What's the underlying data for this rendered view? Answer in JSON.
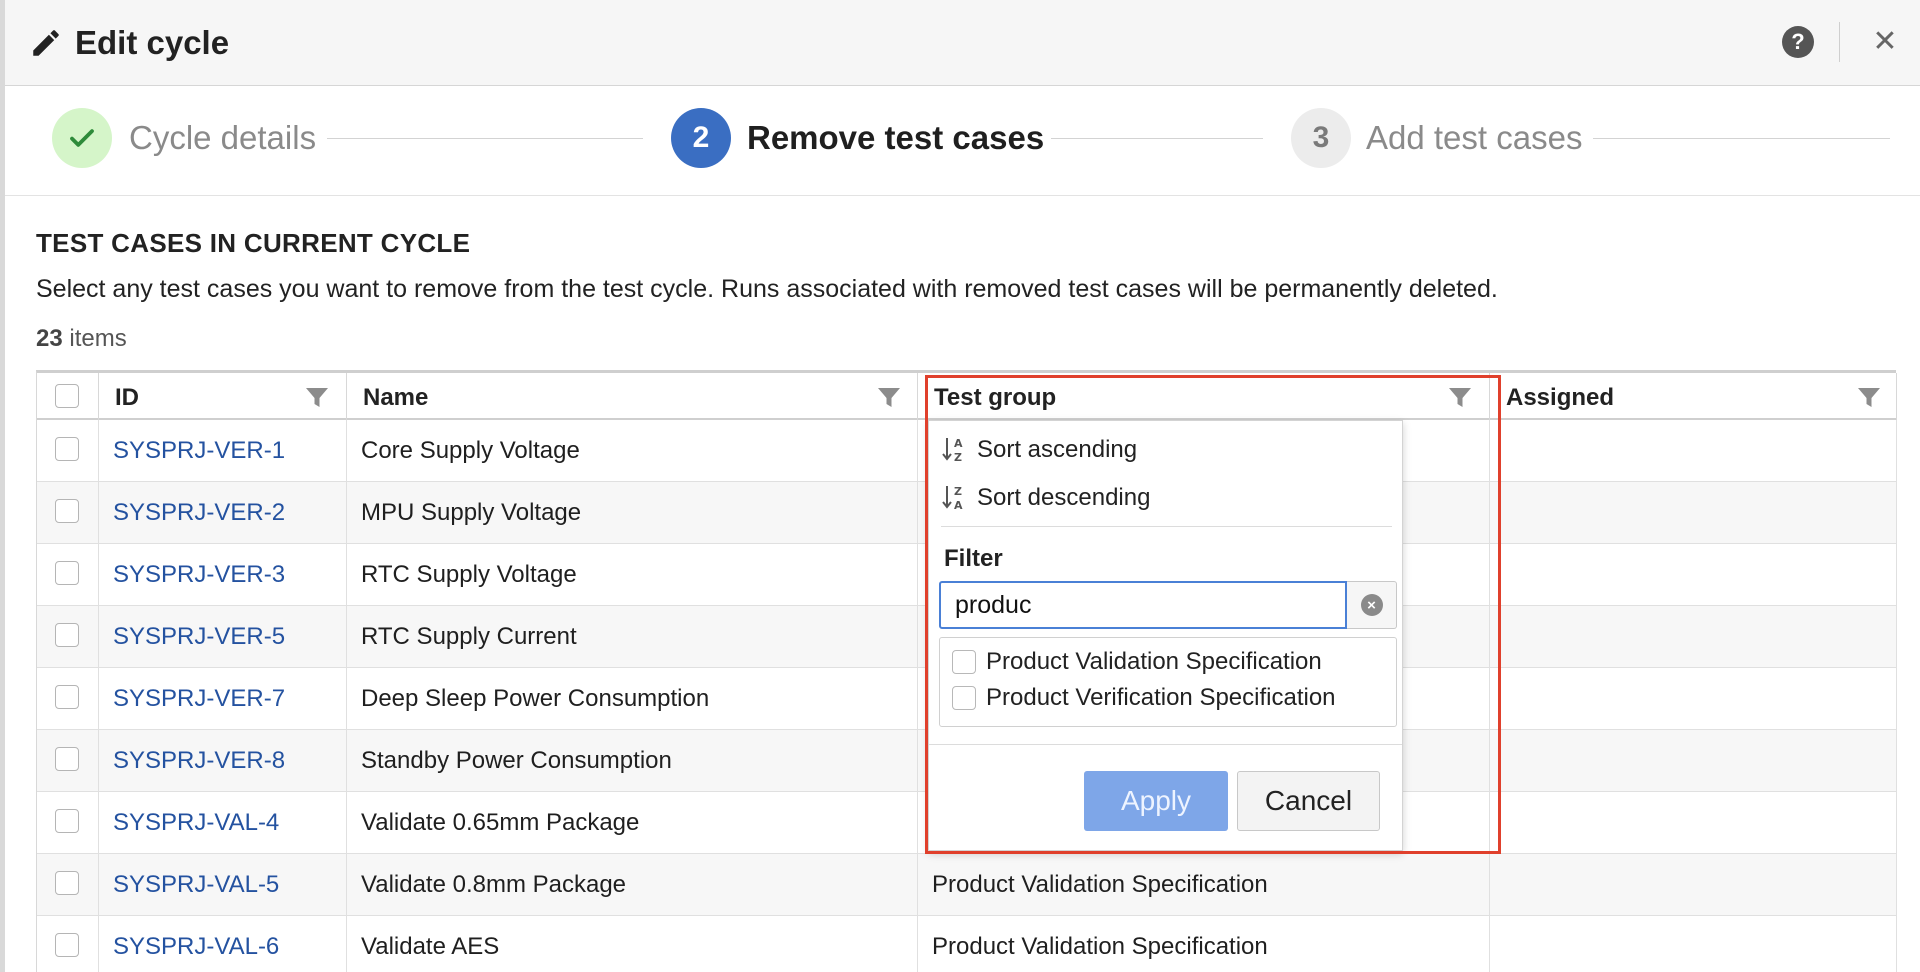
{
  "dialog": {
    "title": "Edit cycle",
    "help_icon": "question-icon",
    "close_icon": "close-icon"
  },
  "steps": [
    {
      "number": "",
      "label": "Cycle details",
      "state": "completed"
    },
    {
      "number": "2",
      "label": "Remove test cases",
      "state": "active"
    },
    {
      "number": "3",
      "label": "Add test cases",
      "state": "pending"
    }
  ],
  "colors": {
    "step_done_bg": "#d5f5c9",
    "step_done_check": "#2e8b3a",
    "step_active_bg": "#3a6ec2",
    "step_pending_bg": "#ececec",
    "link": "#2452a0",
    "highlight_border": "#e0402c",
    "apply_button": "#7ea6e8"
  },
  "section": {
    "title": "TEST CASES IN CURRENT CYCLE",
    "description": "Select any test cases you want to remove from the test cycle. Runs associated with removed test cases will be permanently deleted.",
    "count": "23",
    "count_suffix": " items"
  },
  "table": {
    "columns": [
      "ID",
      "Name",
      "Test group",
      "Assigned"
    ],
    "rows": [
      {
        "id": "SYSPRJ-VER-1",
        "name": "Core Supply Voltage",
        "group": "",
        "assigned": ""
      },
      {
        "id": "SYSPRJ-VER-2",
        "name": "MPU Supply Voltage",
        "group": "",
        "assigned": ""
      },
      {
        "id": "SYSPRJ-VER-3",
        "name": "RTC Supply Voltage",
        "group": "",
        "assigned": ""
      },
      {
        "id": "SYSPRJ-VER-5",
        "name": "RTC Supply Current",
        "group": "",
        "assigned": ""
      },
      {
        "id": "SYSPRJ-VER-7",
        "name": "Deep Sleep Power Consumption",
        "group": "",
        "assigned": ""
      },
      {
        "id": "SYSPRJ-VER-8",
        "name": "Standby Power Consumption",
        "group": "",
        "assigned": ""
      },
      {
        "id": "SYSPRJ-VAL-4",
        "name": "Validate 0.65mm Package",
        "group": "",
        "assigned": ""
      },
      {
        "id": "SYSPRJ-VAL-5",
        "name": "Validate 0.8mm Package",
        "group": "Product Validation Specification",
        "assigned": ""
      },
      {
        "id": "SYSPRJ-VAL-6",
        "name": "Validate AES",
        "group": "Product Validation Specification",
        "assigned": ""
      }
    ]
  },
  "filter_popup": {
    "sort_ascending": "Sort ascending",
    "sort_descending": "Sort descending",
    "filter_label": "Filter",
    "filter_value": "produc",
    "options": [
      "Product Validation Specification",
      "Product Verification Specification"
    ],
    "apply_label": "Apply",
    "cancel_label": "Cancel"
  }
}
